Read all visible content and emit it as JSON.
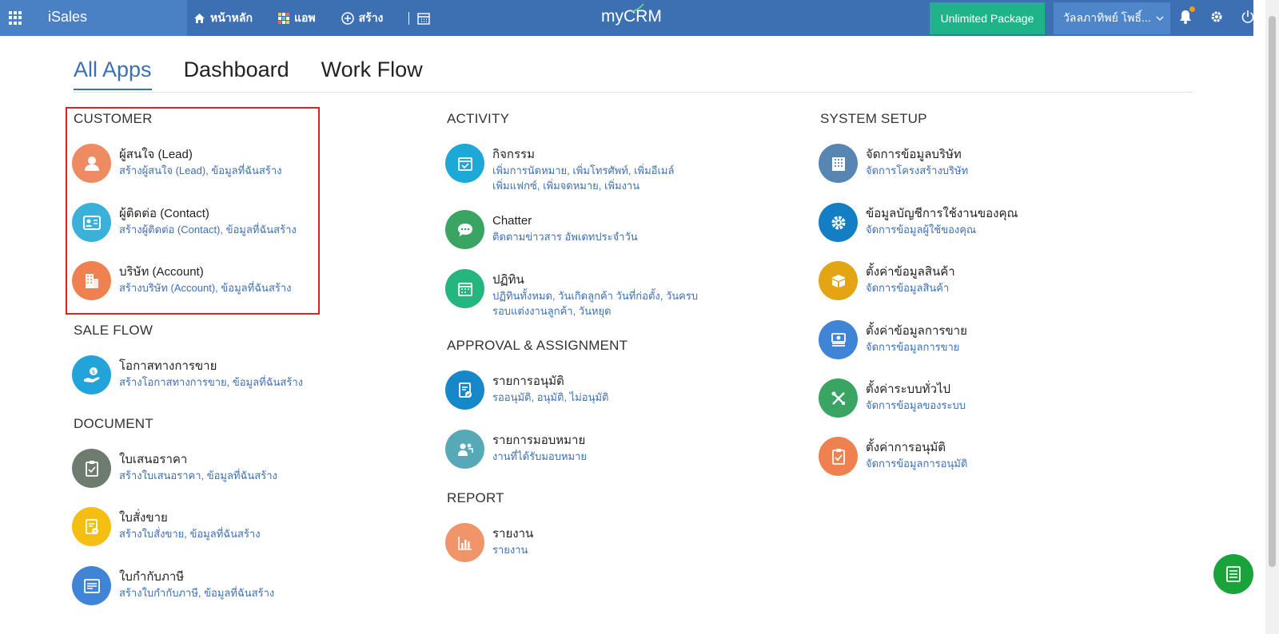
{
  "header": {
    "brand": "iSales",
    "nav": [
      {
        "label": "หน้าหลัก",
        "icon": "home-icon"
      },
      {
        "label": "แอพ",
        "icon": "apps-icon"
      },
      {
        "label": "สร้าง",
        "icon": "plus-circle-icon"
      }
    ],
    "logo": "myCRM",
    "package_button": "Unlimited Package",
    "user_name": "วัลลภาทิพย์ โพธิ์...",
    "colors": {
      "bar": "#3d70b2",
      "package": "#1fb38a",
      "notification_dot": "#f39c12"
    }
  },
  "tabs": [
    {
      "label": "All Apps",
      "active": true
    },
    {
      "label": "Dashboard",
      "active": false
    },
    {
      "label": "Work Flow",
      "active": false
    }
  ],
  "sections": {
    "customer": {
      "title": "CUSTOMER",
      "apps": [
        {
          "title": "ผู้สนใจ (Lead)",
          "subtitle": "สร้างผู้สนใจ (Lead), ข้อมูลที่ฉันสร้าง",
          "icon": "lead-user-icon",
          "color": "#ef8b62"
        },
        {
          "title": "ผู้ติดต่อ (Contact)",
          "subtitle": "สร้างผู้ติดต่อ (Contact), ข้อมูลที่ฉันสร้าง",
          "icon": "contact-card-icon",
          "color": "#3bb0d8"
        },
        {
          "title": "บริษัท (Account)",
          "subtitle": "สร้างบริษัท (Account), ข้อมูลที่ฉันสร้าง",
          "icon": "building-icon",
          "color": "#ef8150"
        }
      ]
    },
    "sale_flow": {
      "title": "SALE FLOW",
      "apps": [
        {
          "title": "โอกาสทางการขาย",
          "subtitle": "สร้างโอกาสทางการขาย, ข้อมูลที่ฉันสร้าง",
          "icon": "money-hand-icon",
          "color": "#22a3d9"
        }
      ]
    },
    "document": {
      "title": "DOCUMENT",
      "apps": [
        {
          "title": "ใบเสนอราคา",
          "subtitle": "สร้างใบเสนอราคา, ข้อมูลที่ฉันสร้าง",
          "icon": "clipboard-icon",
          "color": "#6e7c70"
        },
        {
          "title": "ใบสั่งขาย",
          "subtitle": "สร้างใบสั่งขาย, ข้อมูลที่ฉันสร้าง",
          "icon": "order-doc-icon",
          "color": "#f5be12"
        },
        {
          "title": "ใบกำกับภาษี",
          "subtitle": "สร้างใบกำกับภาษี, ข้อมูลที่ฉันสร้าง",
          "icon": "invoice-icon",
          "color": "#3f84d6"
        }
      ]
    },
    "activity": {
      "title": "ACTIVITY",
      "apps": [
        {
          "title": "กิจกรรม",
          "subtitle": "เพิ่มการนัดหมาย, เพิ่มโทรศัพท์, เพิ่มอีเมล์ เพิ่มแฟกซ์, เพิ่มจดหมาย, เพิ่มงาน",
          "icon": "calendar-check-icon",
          "color": "#1ea8d8"
        },
        {
          "title": "Chatter",
          "subtitle": "ติดตามข่าวสาร อัพเดทประจำวัน",
          "icon": "chat-icon",
          "color": "#3aa563"
        },
        {
          "title": "ปฏิทิน",
          "subtitle": "ปฏิทินทั้งหมด, วันเกิดลูกค้า วันที่ก่อตั้ง, วันครบรอบแต่งงานลูกค้า, วันหยุด",
          "icon": "calendar-icon",
          "color": "#25b57e"
        }
      ]
    },
    "approval": {
      "title": "APPROVAL & ASSIGNMENT",
      "apps": [
        {
          "title": "รายการอนุมัติ",
          "subtitle": "รออนุมัติ, อนุมัติ, ไม่อนุมัติ",
          "icon": "approval-doc-icon",
          "color": "#1687c8"
        },
        {
          "title": "รายการมอบหมาย",
          "subtitle": "งานที่ได้รับมอบหมาย",
          "icon": "assign-people-icon",
          "color": "#58a9b7"
        }
      ]
    },
    "report": {
      "title": "REPORT",
      "apps": [
        {
          "title": "รายงาน",
          "subtitle": "รายงาน",
          "icon": "bar-chart-icon",
          "color": "#f2946a"
        }
      ]
    },
    "system_setup": {
      "title": "SYSTEM SETUP",
      "apps": [
        {
          "title": "จัดการข้อมูลบริษัท",
          "subtitle": "จัดการโครงสร้างบริษัท",
          "icon": "office-building-icon",
          "color": "#5786b3"
        },
        {
          "title": "ข้อมูลบัญชีการใช้งานของคุณ",
          "subtitle": "จัดการข้อมูลผู้ใช้ของคุณ",
          "icon": "gear-icon",
          "color": "#137ec4"
        },
        {
          "title": "ตั้งค่าข้อมูลสินค้า",
          "subtitle": "จัดการข้อมูลสินค้า",
          "icon": "box-icon",
          "color": "#e4a514"
        },
        {
          "title": "ตั้งค่าข้อมูลการขาย",
          "subtitle": "จัดการข้อมูลการขาย",
          "icon": "money-stack-icon",
          "color": "#3f84d6"
        },
        {
          "title": "ตั้งค่าระบบทั่วไป",
          "subtitle": "จัดการข้อมูลของระบบ",
          "icon": "tools-icon",
          "color": "#3aa563"
        },
        {
          "title": "ตั้งค่าการอนุมัติ",
          "subtitle": "จัดการข้อมูลการอนุมัติ",
          "icon": "clipboard-check-icon",
          "color": "#ef8150"
        }
      ]
    }
  },
  "fab": {
    "icon": "document-list-icon",
    "color": "#1aa33b"
  }
}
